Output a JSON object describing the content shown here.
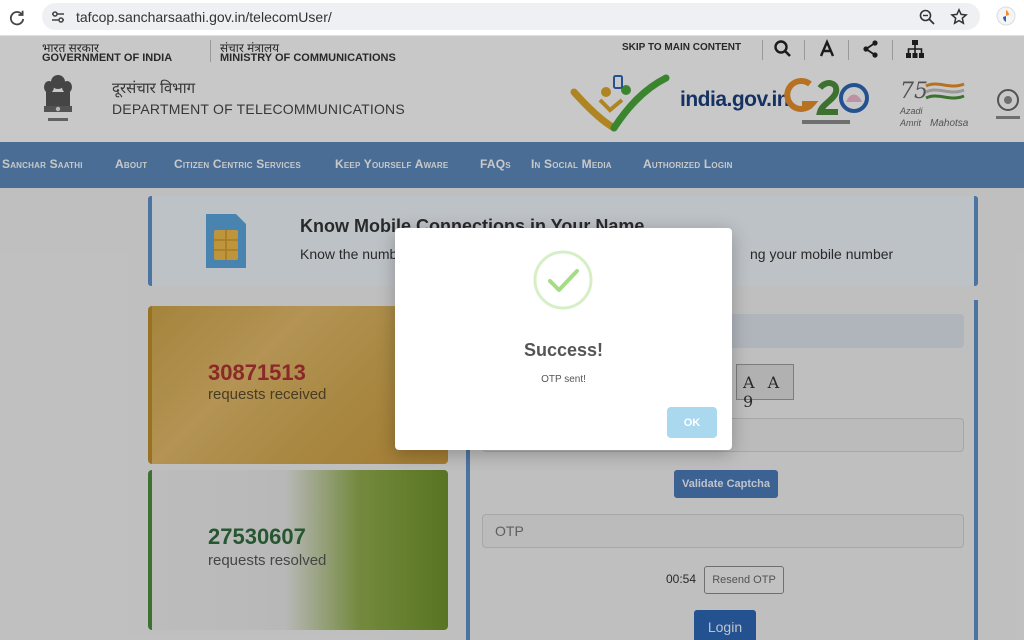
{
  "browser": {
    "url": "tafcop.sancharsaathi.gov.in/telecomUser/",
    "icons": [
      "reload-icon",
      "site-info-icon",
      "zoom-icon",
      "bookmark-star-icon",
      "extension-icon"
    ]
  },
  "gov_strip": {
    "gov_hindi": "भारत सरकार",
    "gov_english": "GOVERNMENT OF INDIA",
    "ministry_hindi": "संचार मंत्रालय",
    "ministry_english": "MINISTRY OF COMMUNICATIONS",
    "skip_link": "SKIP TO MAIN CONTENT",
    "tools": [
      "search-icon",
      "font-size-icon",
      "share-icon",
      "sitemap-icon"
    ]
  },
  "dept": {
    "hindi": "दूरसंचार विभाग",
    "english": "DEPARTMENT OF TELECOMMUNICATIONS",
    "india_gov": "india.gov.in"
  },
  "nav": {
    "items": [
      "Sanchar Saathi",
      "About",
      "Citizen Centric Services",
      "Keep Yourself Aware",
      "FAQs",
      "In Social Media",
      "Authorized Login"
    ]
  },
  "banner": {
    "title": "Know Mobile Connections in Your Name",
    "subtitle_left": "Know the numb",
    "subtitle_right": "ng your mobile number"
  },
  "stats": {
    "received_count": "30871513",
    "received_label": "requests received",
    "resolved_count": "27530607",
    "resolved_label": "requests resolved"
  },
  "form": {
    "captcha_text": "A A 9",
    "validate_label": "Validate Captcha",
    "otp_placeholder": "OTP",
    "timer": "00:54",
    "resend_label": "Resend OTP",
    "login_label": "Login"
  },
  "modal": {
    "title": "Success!",
    "message": "OTP sent!",
    "ok_label": "OK"
  },
  "colors": {
    "nav_bg": "#5b86b8",
    "success_green": "#a5dc86",
    "ok_button": "#a9d8ef",
    "login_button": "#2d64b0"
  }
}
